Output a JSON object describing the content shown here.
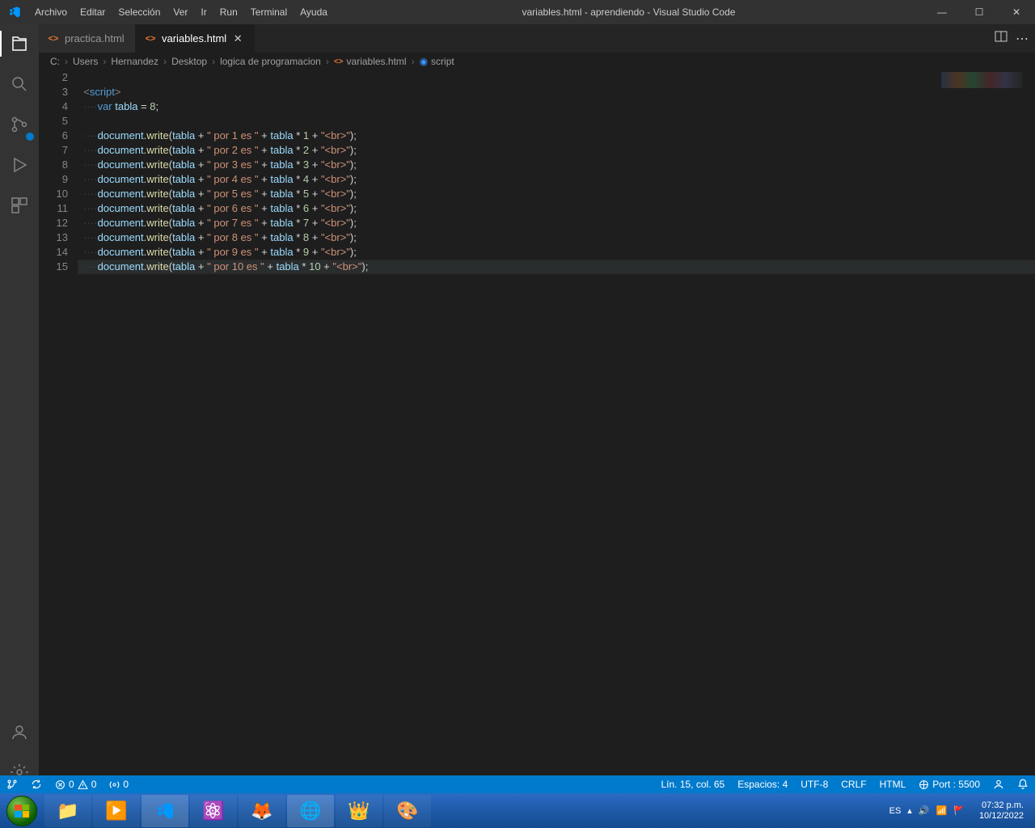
{
  "window": {
    "title": "variables.html - aprendiendo - Visual Studio Code"
  },
  "menu": [
    "Archivo",
    "Editar",
    "Selección",
    "Ver",
    "Ir",
    "Run",
    "Terminal",
    "Ayuda"
  ],
  "tabs": [
    {
      "label": "practica.html",
      "active": false
    },
    {
      "label": "variables.html",
      "active": true
    }
  ],
  "breadcrumbs": {
    "segments": [
      "C:",
      "Users",
      "Hernandez",
      "Desktop",
      "logica de programacion"
    ],
    "file": "variables.html",
    "symbol": "script"
  },
  "editor": {
    "lineNumbers": [
      2,
      3,
      4,
      5,
      6,
      7,
      8,
      9,
      10,
      11,
      12,
      13,
      14,
      15
    ],
    "highlightLine": 15,
    "code": {
      "scriptOpen": "script",
      "varKeyword": "var",
      "varName": "tabla",
      "varValue": "8",
      "obj": "document",
      "fn": "write",
      "arg": "tabla",
      "strPrefix": "\" por ",
      "strMid": " es \"",
      "brStr": "\"<br>\"",
      "multipliers": [
        1,
        2,
        3,
        4,
        5,
        6,
        7,
        8,
        9,
        10
      ]
    }
  },
  "statusbar": {
    "branch": "",
    "errors": "0",
    "warnings": "0",
    "radio": "0",
    "cursor": "Lín. 15, col. 65",
    "spaces": "Espacios: 4",
    "encoding": "UTF-8",
    "eol": "CRLF",
    "lang": "HTML",
    "port": "Port : 5500"
  },
  "taskbar": {
    "lang": "ES",
    "time": "07:32 p.m.",
    "date": "10/12/2022"
  },
  "activity_badge": "1"
}
